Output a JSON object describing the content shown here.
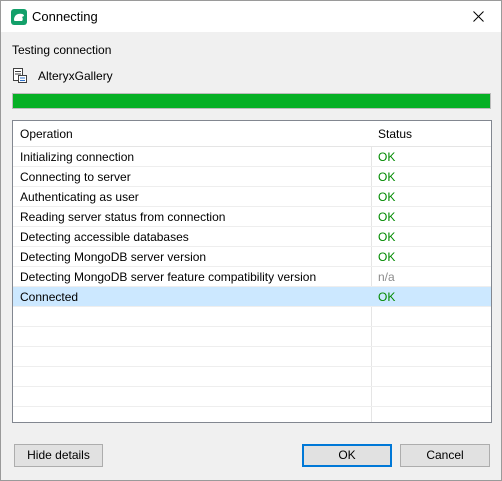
{
  "window": {
    "title": "Connecting",
    "icon": "app-logo-icon",
    "close_icon": "close-icon"
  },
  "heading": "Testing connection",
  "connection": {
    "name": "AlteryxGallery",
    "icon": "database-icon"
  },
  "progress": {
    "value": 1.0,
    "color": "#06b025"
  },
  "table": {
    "columns": [
      "Operation",
      "Status"
    ],
    "rows": [
      {
        "operation": "Initializing connection",
        "status": "OK"
      },
      {
        "operation": "Connecting to server",
        "status": "OK"
      },
      {
        "operation": "Authenticating as user",
        "status": "OK"
      },
      {
        "operation": "Reading server status from connection",
        "status": "OK"
      },
      {
        "operation": "Detecting accessible databases",
        "status": "OK"
      },
      {
        "operation": "Detecting MongoDB server version",
        "status": "OK"
      },
      {
        "operation": "Detecting MongoDB server feature compatibility version",
        "status": "n/a"
      },
      {
        "operation": "Connected",
        "status": "OK"
      }
    ],
    "selected_row": 7,
    "status_colors": {
      "ok": "#008a00",
      "na": "#8c8c8c"
    },
    "selection_color": "#cce8ff"
  },
  "buttons": {
    "hide_details": "Hide details",
    "ok": "OK",
    "cancel": "Cancel"
  }
}
